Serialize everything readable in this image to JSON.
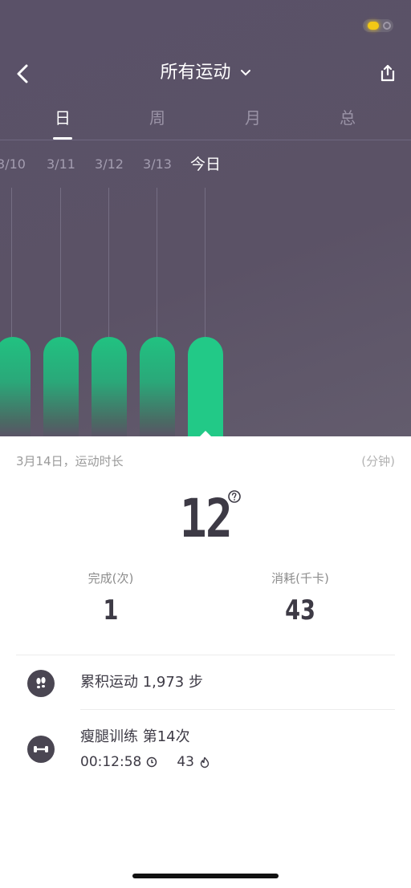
{
  "header": {
    "title": "所有运动",
    "back_icon": "chevron-left-icon",
    "share_icon": "share-icon"
  },
  "tabs": [
    {
      "label": "日",
      "active": true
    },
    {
      "label": "周",
      "active": false
    },
    {
      "label": "月",
      "active": false
    },
    {
      "label": "总",
      "active": false
    }
  ],
  "chart_data": {
    "type": "bar",
    "categories": [
      "3/10",
      "3/11",
      "3/12",
      "3/13",
      "今日"
    ],
    "highlight": "今日",
    "colors": {
      "bar": "#22c987",
      "background": "#5b5266"
    }
  },
  "summary": {
    "date_label": "3月14日，运动时长",
    "unit": "(分钟)",
    "duration_value": "12",
    "completed_label": "完成(次)",
    "completed_value": "1",
    "calories_label": "消耗(千卡)",
    "calories_value": "43"
  },
  "activities": [
    {
      "icon": "footsteps-icon",
      "text": "累积运动 1,973 步"
    },
    {
      "icon": "dumbbell-icon",
      "title": "瘦腿训练  第14次",
      "time": "00:12:58",
      "calories": "43"
    }
  ],
  "colors": {
    "accent": "#22c987",
    "header_bg": "#5b5266",
    "text_dark": "#3d3a45"
  }
}
